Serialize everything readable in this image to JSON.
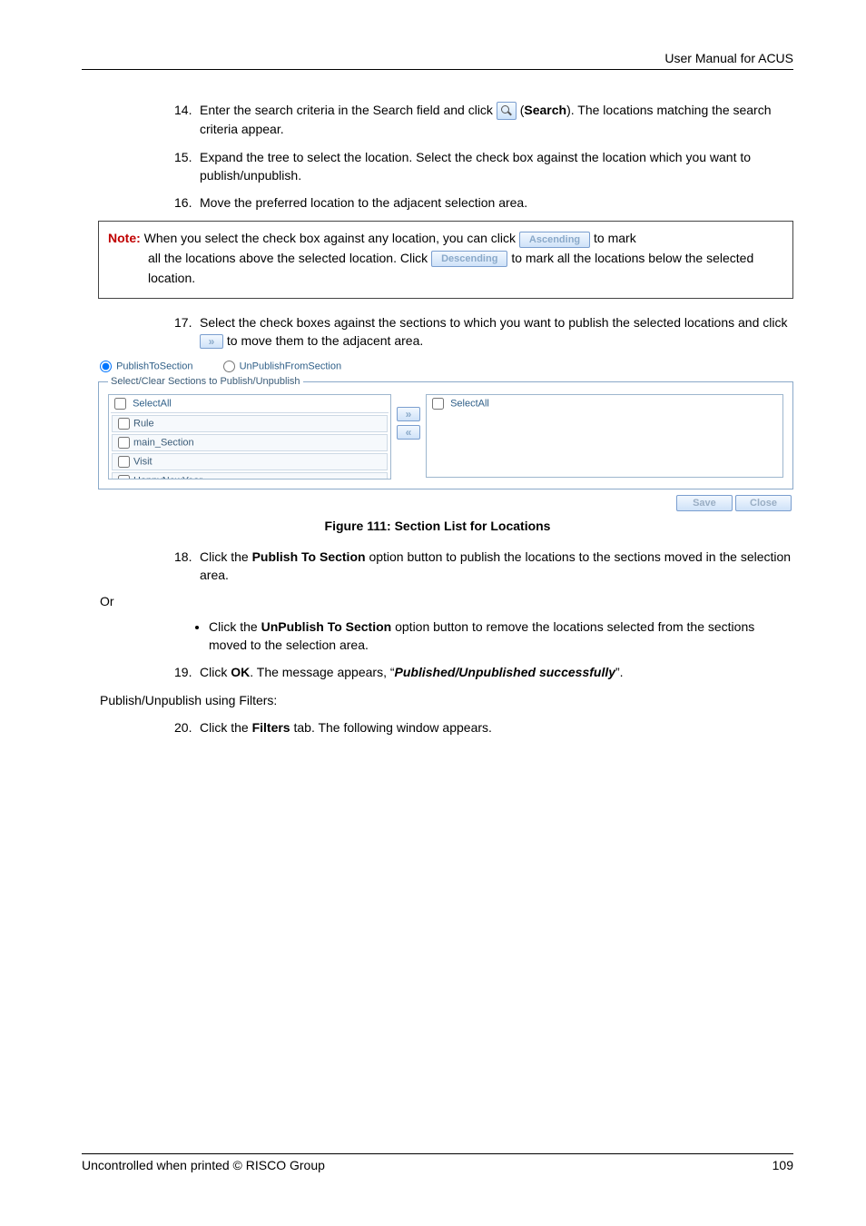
{
  "header": {
    "title": "User Manual for ACUS"
  },
  "steps": {
    "s14": {
      "num": "14.",
      "t1": "Enter the search criteria in the Search field and click",
      "t2": "(",
      "search_bold": "Search",
      "t3": "). The locations matching the search criteria appear."
    },
    "s15": {
      "num": "15.",
      "text": "Expand the tree to select the location. Select the check box against the location which you want to publish/unpublish."
    },
    "s16": {
      "num": "16.",
      "text": "Move the preferred location to the adjacent selection area."
    },
    "s17": {
      "num": "17.",
      "t1": "Select the check boxes against the sections to which you want to publish the selected locations and click",
      "t2": "to move them to the adjacent area."
    },
    "s18": {
      "num": "18.",
      "t1": "Click the",
      "b1": "Publish To Section",
      "t2": "option button to publish the locations to the sections moved in the selection area."
    },
    "s19": {
      "num": "19.",
      "t1": "Click",
      "b1": "OK",
      "t2": ". The message appears, “",
      "bi1": "Published/Unpublished successfully",
      "t3": "”."
    },
    "s20": {
      "num": "20.",
      "t1": "Click the",
      "b1": "Filters",
      "t2": "tab. The following window appears."
    }
  },
  "note": {
    "label": "Note:",
    "t1": "When you select the check box against any location, you can click",
    "btn_asc": "Ascending",
    "t2": "to mark all the locations above the selected location. Click",
    "btn_desc": "Descending",
    "t3": "to mark all the locations below the selected location."
  },
  "move_btn": "»",
  "screenshot": {
    "radio1": "PublishToSection",
    "radio2": "UnPublishFromSection",
    "legend": "Select/Clear Sections to Publish/Unpublish",
    "select_all": "SelectAll",
    "items": [
      "Rule",
      "main_Section",
      "Visit",
      "HappyNewYear"
    ],
    "btn_right": "»",
    "btn_left": "«",
    "save": "Save",
    "close": "Close"
  },
  "figure_caption": "Figure 111: Section List for Locations",
  "or": "Or",
  "bullet": {
    "t1": "Click the",
    "b1": "UnPublish To Section",
    "t2": "option button to remove the locations selected from the sections moved to the selection area."
  },
  "para_filters": "Publish/Unpublish using Filters:",
  "footer": {
    "left": "Uncontrolled when printed © RISCO Group",
    "right": "109"
  }
}
